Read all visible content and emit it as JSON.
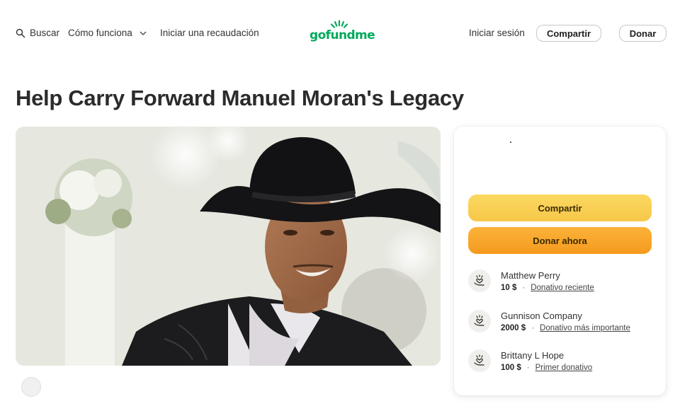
{
  "header": {
    "search_label": "Buscar",
    "how_it_works_label": "Cómo funciona",
    "start_fundraiser_label": "Iniciar una recaudación",
    "logo_text": "gofundme",
    "sign_in_label": "Iniciar sesión",
    "share_label": "Compartir",
    "donate_label": "Donar"
  },
  "page": {
    "title": "Help Carry Forward Manuel Moran's Legacy"
  },
  "card": {
    "share_label": "Compartir",
    "donate_now_label": "Donar ahora",
    "donations": [
      {
        "name": "Matthew Perry",
        "amount": "10 $",
        "tag": "Donativo reciente"
      },
      {
        "name": "Gunnison Company",
        "amount": "2000 $",
        "tag": "Donativo más importante"
      },
      {
        "name": "Brittany L Hope",
        "amount": "100 $",
        "tag": "Primer donativo"
      }
    ]
  },
  "colors": {
    "brand_green": "#02a95c",
    "share_yellow": "#f9cf55",
    "donate_orange": "#f8a42a"
  },
  "icons": {
    "search": "search-icon",
    "dropdown": "chevron-down-icon",
    "donation": "heart-hand-icon"
  }
}
